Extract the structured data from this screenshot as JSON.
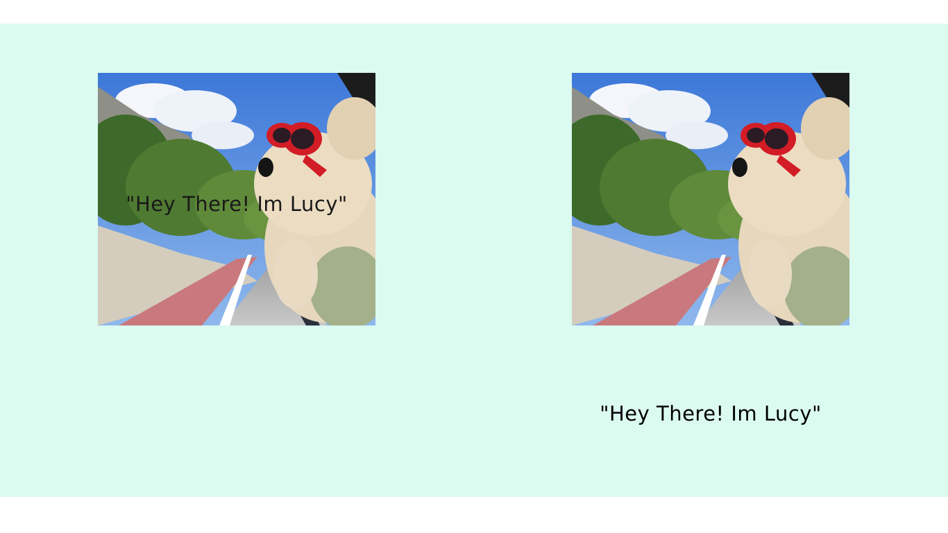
{
  "cards": [
    {
      "image": {
        "icon": "dog-photo",
        "alt": ""
      },
      "caption": "\"Hey There! Im Lucy\""
    },
    {
      "image": {
        "icon": "dog-photo",
        "alt": ""
      },
      "caption": "\"Hey There! Im Lucy\""
    }
  ],
  "colors": {
    "band_background": "#dbfaf0",
    "page_background": "#ffffff",
    "caption_color": "#000000"
  }
}
